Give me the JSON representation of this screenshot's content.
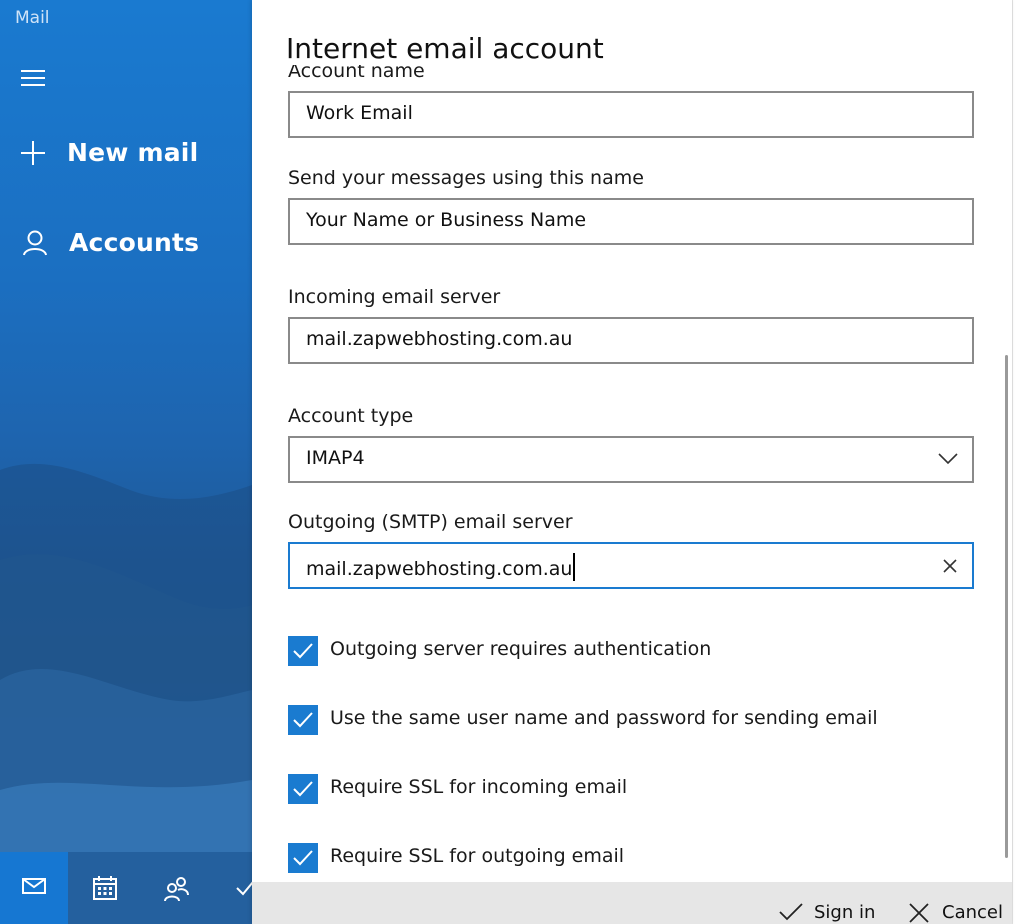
{
  "app": {
    "title": "Mail"
  },
  "sidebar": {
    "new_mail_label": "New mail",
    "accounts_label": "Accounts",
    "bottom_icons": [
      "mail-icon",
      "calendar-icon",
      "people-icon",
      "todo-icon"
    ]
  },
  "dialog": {
    "title": "Internet email account",
    "fields": {
      "account_name": {
        "label": "Account name",
        "value": "Work Email"
      },
      "send_name": {
        "label": "Send your messages using this name",
        "value": "Your Name or Business Name"
      },
      "incoming_server": {
        "label": "Incoming email server",
        "value": "mail.zapwebhosting.com.au"
      },
      "account_type": {
        "label": "Account type",
        "value": "IMAP4"
      },
      "outgoing_server": {
        "label": "Outgoing (SMTP) email server",
        "value": "mail.zapwebhosting.com.au"
      }
    },
    "checkboxes": [
      {
        "label": "Outgoing server requires authentication",
        "checked": true
      },
      {
        "label": "Use the same user name and password for sending email",
        "checked": true
      },
      {
        "label": "Require SSL for incoming email",
        "checked": true
      },
      {
        "label": "Require SSL for outgoing email",
        "checked": true
      }
    ],
    "footer": {
      "sign_in_label": "Sign in",
      "cancel_label": "Cancel"
    }
  },
  "colors": {
    "accent": "#1a7bd0",
    "sidebar": "#1b6fc1",
    "footer": "#e6e6e6"
  }
}
